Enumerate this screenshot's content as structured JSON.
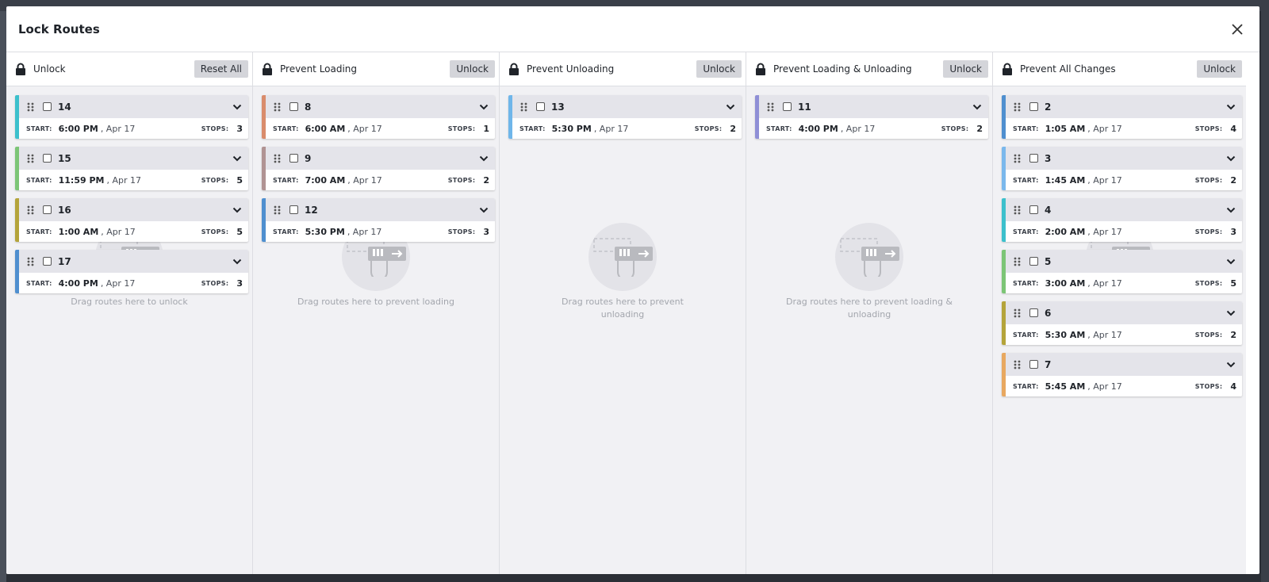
{
  "modal": {
    "title": "Lock Routes"
  },
  "columns": [
    {
      "title": "Unlock",
      "button": "Reset All",
      "drop_text": "Drag routes here to unlock",
      "routes": [
        {
          "num": "14",
          "color": "#3cc0cc",
          "time": "6:00 PM",
          "date": ", Apr 17",
          "stops": "3"
        },
        {
          "num": "15",
          "color": "#7cc576",
          "time": "11:59 PM",
          "date": ", Apr 17",
          "stops": "5"
        },
        {
          "num": "16",
          "color": "#b4a43a",
          "time": "1:00 AM",
          "date": ", Apr 17",
          "stops": "5"
        },
        {
          "num": "17",
          "color": "#4f8fcf",
          "time": "4:00 PM",
          "date": ", Apr 17",
          "stops": "3"
        }
      ]
    },
    {
      "title": "Prevent Loading",
      "button": "Unlock",
      "drop_text": "Drag routes here to prevent loading",
      "routes": [
        {
          "num": "8",
          "color": "#d98c6c",
          "time": "6:00 AM",
          "date": ", Apr 17",
          "stops": "1"
        },
        {
          "num": "9",
          "color": "#b09393",
          "time": "7:00 AM",
          "date": ", Apr 17",
          "stops": "2"
        },
        {
          "num": "12",
          "color": "#4f8fcf",
          "time": "5:30 PM",
          "date": ", Apr 17",
          "stops": "3"
        }
      ]
    },
    {
      "title": "Prevent Unloading",
      "button": "Unlock",
      "drop_text": "Drag routes here to prevent unloading",
      "routes": [
        {
          "num": "13",
          "color": "#6fb6ea",
          "time": "5:30 PM",
          "date": ", Apr 17",
          "stops": "2"
        }
      ]
    },
    {
      "title": "Prevent Loading & Unloading",
      "button": "Unlock",
      "drop_text": "Drag routes here to prevent loading & unloading",
      "routes": [
        {
          "num": "11",
          "color": "#8f8fd6",
          "time": "4:00 PM",
          "date": ", Apr 17",
          "stops": "2"
        }
      ]
    },
    {
      "title": "Prevent All Changes",
      "button": "Unlock",
      "drop_text": "",
      "routes": [
        {
          "num": "2",
          "color": "#4f8fcf",
          "time": "1:05 AM",
          "date": ", Apr 17",
          "stops": "4"
        },
        {
          "num": "3",
          "color": "#7ab8ec",
          "time": "1:45 AM",
          "date": ", Apr 17",
          "stops": "2"
        },
        {
          "num": "4",
          "color": "#3cc0cc",
          "time": "2:00 AM",
          "date": ", Apr 17",
          "stops": "3"
        },
        {
          "num": "5",
          "color": "#7cc576",
          "time": "3:00 AM",
          "date": ", Apr 17",
          "stops": "5"
        },
        {
          "num": "6",
          "color": "#b4a43a",
          "time": "5:30 AM",
          "date": ", Apr 17",
          "stops": "2"
        },
        {
          "num": "7",
          "color": "#e8a860",
          "time": "5:45 AM",
          "date": ", Apr 17",
          "stops": "4"
        }
      ]
    }
  ],
  "labels": {
    "start": "START:",
    "stops": "STOPS:"
  }
}
